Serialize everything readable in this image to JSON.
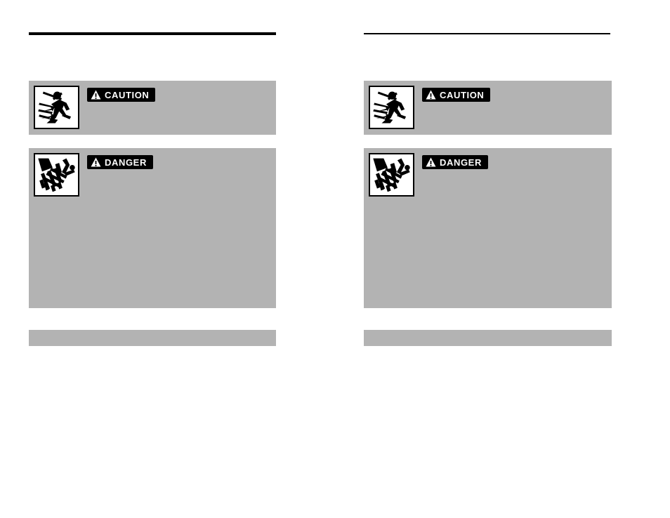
{
  "page": {
    "background_color": "#ffffff",
    "panel_gray": "#b3b3b3",
    "rule_color": "#000000"
  },
  "columns": [
    {
      "id": "left",
      "header": {
        "text": ""
      },
      "body": {
        "text": ""
      },
      "panels": [
        {
          "id": "caution",
          "signal_word": "CAUTION",
          "icon": "thrown-object-hazard-icon",
          "body": {
            "text": ""
          }
        },
        {
          "id": "danger",
          "signal_word": "DANGER",
          "icon": "rotating-tine-entanglement-hazard-icon",
          "body": {
            "text": ""
          }
        },
        {
          "id": "footer",
          "signal_word": "",
          "icon": "",
          "body": {
            "text": ""
          }
        }
      ]
    },
    {
      "id": "right",
      "header": {
        "text": ""
      },
      "body": {
        "text": ""
      },
      "panels": [
        {
          "id": "caution",
          "signal_word": "CAUTION",
          "icon": "thrown-object-hazard-icon",
          "body": {
            "text": ""
          }
        },
        {
          "id": "danger",
          "signal_word": "DANGER",
          "icon": "rotating-tine-entanglement-hazard-icon",
          "body": {
            "text": ""
          }
        },
        {
          "id": "footer",
          "signal_word": "",
          "icon": "",
          "body": {
            "text": ""
          }
        }
      ]
    }
  ]
}
